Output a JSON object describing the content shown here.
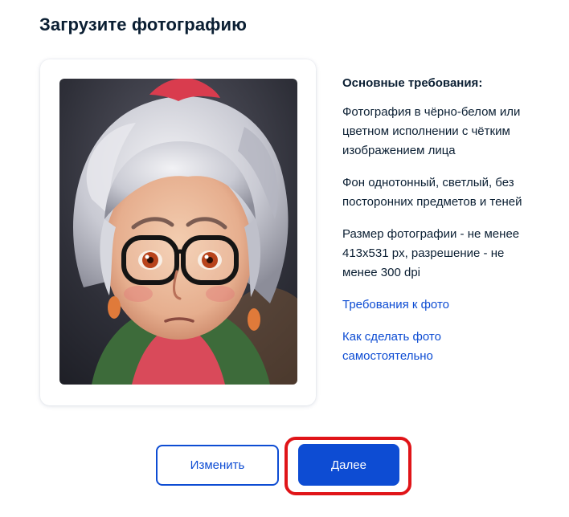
{
  "page": {
    "title": "Загрузите фотографию"
  },
  "photo": {
    "alt": "Загруженная фотография",
    "description_icon": "portrait-photo"
  },
  "requirements": {
    "heading": "Основные требования:",
    "items": [
      "Фотография в чёрно-белом или цветном исполнении с чётким изображением лица",
      "Фон однотонный, светлый, без посторонних предметов и теней",
      "Размер фотографии - не менее 413x531 px, разрешение - не менее 300 dpi"
    ],
    "links": [
      "Требования к фото",
      "Как сделать фото самостоятельно"
    ]
  },
  "actions": {
    "change_label": "Изменить",
    "next_label": "Далее"
  },
  "colors": {
    "accent": "#0d4cd3",
    "text": "#0b1f33",
    "highlight": "#e01418"
  }
}
